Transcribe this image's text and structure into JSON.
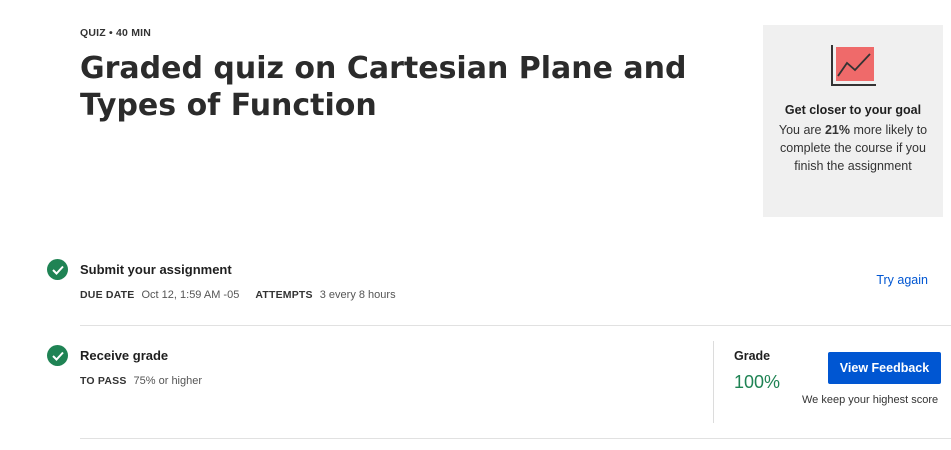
{
  "header": {
    "meta": "QUIZ • 40 MIN",
    "title": "Graded quiz on Cartesian Plane and Types of Function"
  },
  "goal_card": {
    "icon": "trend-chart-icon",
    "title": "Get closer to your goal",
    "text_before": "You are ",
    "percent": "21%",
    "text_after": " more likely to complete the course if you finish the assignment",
    "accent_color": "#ef6a6a"
  },
  "submit": {
    "title": "Submit your assignment",
    "due_label": "DUE DATE",
    "due_value": "Oct 12, 1:59 AM -05",
    "attempts_label": "ATTEMPTS",
    "attempts_value": "3 every 8 hours",
    "try_again": "Try again"
  },
  "receive": {
    "title": "Receive grade",
    "pass_label": "TO PASS",
    "pass_value": "75% or higher",
    "grade_label": "Grade",
    "grade_value": "100%",
    "view_feedback": "View Feedback",
    "keep_note": "We keep your highest score"
  },
  "colors": {
    "success": "#1f8354",
    "primary": "#0056d2"
  }
}
